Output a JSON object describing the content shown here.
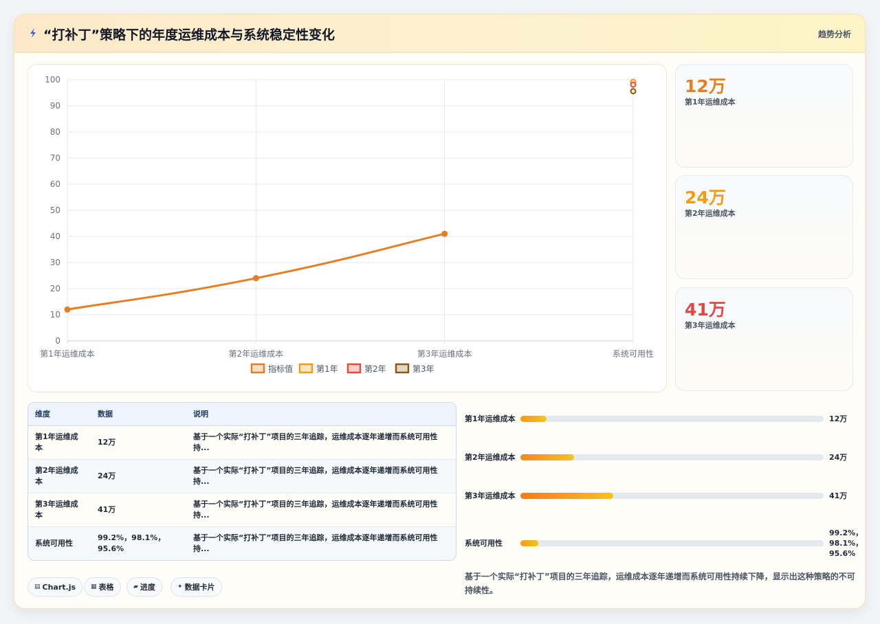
{
  "header": {
    "title": "“打补丁”策略下的年度运维成本与系统稳定性变化",
    "tag": "趋势分析"
  },
  "colors": {
    "primary": "#e67e22",
    "year1": "#f39c12",
    "year2": "#e74c3c",
    "year3": "#8b5a13"
  },
  "chart_data": {
    "type": "line",
    "categories": [
      "第1年运维成本",
      "第2年运维成本",
      "第3年运维成本",
      "系统可用性"
    ],
    "ylim": [
      0,
      100
    ],
    "yticks": [
      0,
      10,
      20,
      30,
      40,
      50,
      60,
      70,
      80,
      90,
      100
    ],
    "series": [
      {
        "name": "指标值",
        "color": "#e67e22",
        "values": [
          12,
          24,
          41,
          null
        ]
      },
      {
        "name": "第1年",
        "color": "#f39c12",
        "values": [
          null,
          null,
          null,
          99.2
        ]
      },
      {
        "name": "第2年",
        "color": "#e74c3c",
        "values": [
          null,
          null,
          null,
          98.1
        ]
      },
      {
        "name": "第3年",
        "color": "#8b5a13",
        "values": [
          null,
          null,
          null,
          95.6
        ]
      }
    ],
    "legend_position": "bottom",
    "grid": true
  },
  "stats": [
    {
      "value": "12万",
      "label": "第1年运维成本",
      "color": "#e67e22"
    },
    {
      "value": "24万",
      "label": "第2年运维成本",
      "color": "#f39c12"
    },
    {
      "value": "41万",
      "label": "第3年运维成本",
      "color": "#e04848"
    }
  ],
  "table": {
    "headers": [
      "维度",
      "数据",
      "说明"
    ],
    "rows": [
      [
        "第1年运维成本",
        "12万",
        "基于一个实际“打补丁”项目的三年追踪，运维成本逐年递增而系统可用性持..."
      ],
      [
        "第2年运维成本",
        "24万",
        "基于一个实际“打补丁”项目的三年追踪，运维成本逐年递增而系统可用性持..."
      ],
      [
        "第3年运维成本",
        "41万",
        "基于一个实际“打补丁”项目的三年追踪，运维成本逐年递增而系统可用性持..."
      ],
      [
        "系统可用性",
        "99.2%，98.1%，95.6%",
        "基于一个实际“打补丁”项目的三年追踪，运维成本逐年递增而系统可用性持..."
      ]
    ]
  },
  "progress": [
    {
      "label": "第1年运维成本",
      "value": "12万",
      "fraction": 0.087
    },
    {
      "label": "第2年运维成本",
      "value": "24万",
      "fraction": 0.177
    },
    {
      "label": "第3年运维成本",
      "value": "41万",
      "fraction": 0.305
    },
    {
      "label": "系统可用性",
      "value": "99.2%，98.1%，95.6%",
      "fraction": 0.06
    }
  ],
  "summary": "基于一个实际“打补丁”项目的三年追踪，运维成本逐年递增而系统可用性持续下降，显示出这种策略的不可持续性。",
  "tech_tags": [
    {
      "icon": "▤",
      "label": "Chart.js"
    },
    {
      "icon": "▦",
      "label": "表格"
    },
    {
      "icon": "▰",
      "label": "进度"
    },
    {
      "icon": "✦",
      "label": "数据卡片"
    }
  ]
}
